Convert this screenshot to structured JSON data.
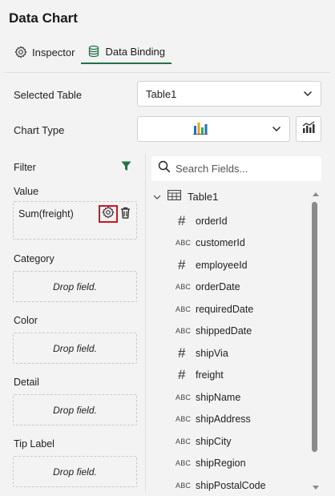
{
  "panel": {
    "title": "Data Chart"
  },
  "tabs": [
    {
      "label": "Inspector",
      "icon": "gear-icon",
      "active": false
    },
    {
      "label": "Data Binding",
      "icon": "database-icon",
      "active": true
    }
  ],
  "selected_table": {
    "label": "Selected Table",
    "value": "Table1"
  },
  "chart_type": {
    "label": "Chart Type",
    "value_icon": "bar-chart-icon",
    "side_button_icon": "chart-settings-icon"
  },
  "filter": {
    "label": "Filter",
    "icon": "filter-icon",
    "color": "#217346"
  },
  "value_section": {
    "label": "Value",
    "item": "Sum(freight)",
    "highlight_color": "#d0141e"
  },
  "category_section": {
    "label": "Category",
    "placeholder": "Drop field."
  },
  "color_section": {
    "label": "Color",
    "placeholder": "Drop field."
  },
  "detail_section": {
    "label": "Detail",
    "placeholder": "Drop field."
  },
  "tip_label_section": {
    "label": "Tip Label",
    "placeholder": "Drop field."
  },
  "search": {
    "placeholder": "Search Fields..."
  },
  "tree": {
    "root_label": "Table1",
    "fields": [
      {
        "name": "orderId",
        "type": "number",
        "type_glyph": "#"
      },
      {
        "name": "customerId",
        "type": "string",
        "type_glyph": "ABC"
      },
      {
        "name": "employeeId",
        "type": "number",
        "type_glyph": "#"
      },
      {
        "name": "orderDate",
        "type": "string",
        "type_glyph": "ABC"
      },
      {
        "name": "requiredDate",
        "type": "string",
        "type_glyph": "ABC"
      },
      {
        "name": "shippedDate",
        "type": "string",
        "type_glyph": "ABC"
      },
      {
        "name": "shipVia",
        "type": "number",
        "type_glyph": "#"
      },
      {
        "name": "freight",
        "type": "number",
        "type_glyph": "#"
      },
      {
        "name": "shipName",
        "type": "string",
        "type_glyph": "ABC"
      },
      {
        "name": "shipAddress",
        "type": "string",
        "type_glyph": "ABC"
      },
      {
        "name": "shipCity",
        "type": "string",
        "type_glyph": "ABC"
      },
      {
        "name": "shipRegion",
        "type": "string",
        "type_glyph": "ABC"
      },
      {
        "name": "shipPostalCode",
        "type": "string",
        "type_glyph": "ABC"
      }
    ]
  },
  "colors": {
    "accent": "#217346",
    "background": "#f3f3f3",
    "highlight": "#d0141e"
  }
}
